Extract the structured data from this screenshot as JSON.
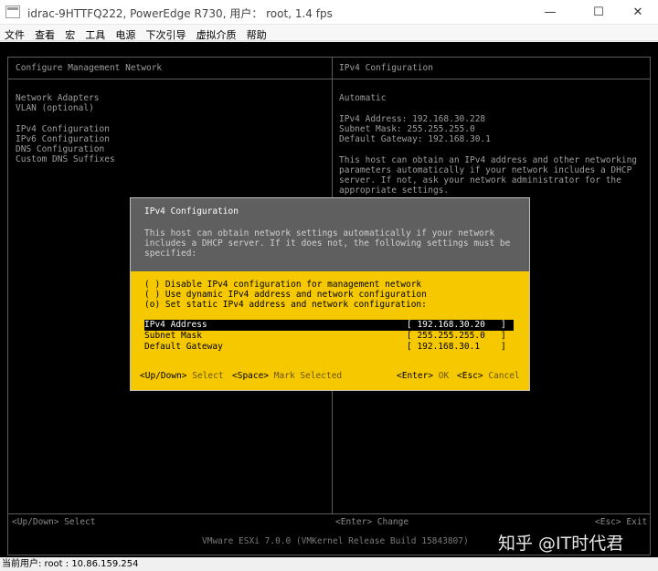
{
  "window": {
    "title": "idrac-9HTTFQ222, PowerEdge R730, 用户： root, 1.4 fps",
    "minimize_glyph": "—",
    "maximize_glyph": "☐",
    "close_glyph": "✕"
  },
  "menu": [
    "文件",
    "查看",
    "宏",
    "工具",
    "电源",
    "下次引导",
    "虚拟介质",
    "帮助"
  ],
  "screen": {
    "left_header": "Configure Management Network",
    "right_header": "IPv4 Configuration",
    "menu_items": [
      "Network Adapters",
      "VLAN (optional)",
      "IPv4 Configuration",
      "IPv6 Configuration",
      "DNS Configuration",
      "Custom DNS Suffixes"
    ],
    "right_mode": "Automatic",
    "current": {
      "address": "IPv4 Address: 192.168.30.228",
      "subnet": "Subnet Mask: 255.255.255.0",
      "gateway": "Default Gateway: 192.168.30.1"
    },
    "info_lines": [
      "This host can obtain an IPv4 address and other networking",
      "parameters automatically if your network includes a DHCP",
      "server. If not, ask your network administrator for the",
      "appropriate settings."
    ],
    "help_left": "<Up/Down> Select",
    "help_mid": "<Enter> Change",
    "help_right": "<Esc> Exit",
    "footer": "VMware ESXi 7.0.0 (VMKernel Release Build 15843807)",
    "watermark": "知乎 @IT时代君"
  },
  "dialog": {
    "title": "IPv4 Configuration",
    "description": [
      "This host can obtain network settings automatically if your network",
      "includes a DHCP server. If it does not, the following settings must be",
      "specified:"
    ],
    "options": [
      "( ) Disable IPv4 configuration for management network",
      "( ) Use dynamic IPv4 address and network configuration",
      "(o) Set static IPv4 address and network configuration:"
    ],
    "fields": [
      {
        "label": "IPv4 Address",
        "value": "[ 192.168.30.20   ]"
      },
      {
        "label": "Subnet Mask",
        "value": "[ 255.255.255.0   ]"
      },
      {
        "label": "Default Gateway",
        "value": "[ 192.168.30.1    ]"
      }
    ],
    "keys": {
      "updown": "<Up/Down>",
      "updown_desc": "Select",
      "space": "<Space>",
      "space_desc": "Mark Selected",
      "enter": "<Enter>",
      "enter_desc": "OK",
      "esc": "<Esc>",
      "esc_desc": "Cancel"
    }
  },
  "status": {
    "text": "当前用户:  root : 10.86.159.254"
  },
  "colors": {
    "dialog_bg": "#f5c800",
    "dialog_header": "#5f5f5f",
    "console_bg": "#000000"
  }
}
